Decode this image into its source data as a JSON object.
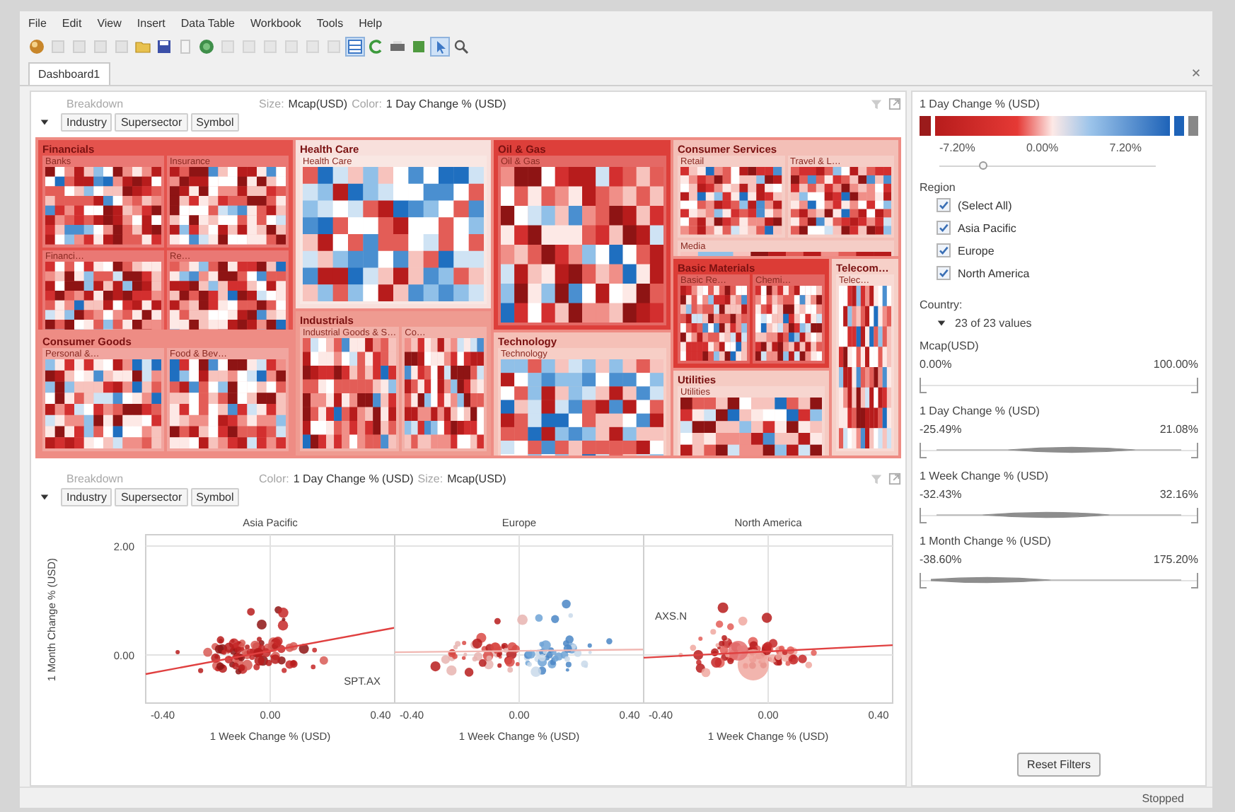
{
  "menu": [
    "File",
    "Edit",
    "View",
    "Insert",
    "Data Table",
    "Workbook",
    "Tools",
    "Help"
  ],
  "tabs": [
    {
      "label": "Dashboard1",
      "selected": true
    }
  ],
  "treemap": {
    "breakdown_label": "Breakdown",
    "size_label": "Size:",
    "size_value": "Mcap(USD)",
    "color_label": "Color:",
    "color_value": "1 Day Change % (USD)",
    "hierarchy": [
      "Industry",
      "Supersector",
      "Symbol"
    ],
    "groups": [
      {
        "label": "Financials",
        "color": "#e4534d",
        "subgroups": [
          "Banks",
          "Insurance",
          "Financi…",
          "Re…"
        ]
      },
      {
        "label": "Health Care",
        "color": "#f8e0dc",
        "subgroups": [
          "Health Care"
        ]
      },
      {
        "label": "Oil & Gas",
        "color": "#dd3f3a",
        "subgroups": [
          "Oil & Gas"
        ]
      },
      {
        "label": "Consumer Services",
        "color": "#f3bfb7",
        "subgroups": [
          "Retail",
          "Travel & L…",
          "Media"
        ]
      },
      {
        "label": "Basic Materials",
        "color": "#dc3c36",
        "subgroups": [
          "Basic Re…",
          "Chemi…"
        ]
      },
      {
        "label": "Telecom…",
        "color": "#f6d0c8",
        "subgroups": [
          "Telec…"
        ]
      },
      {
        "label": "Consumer Goods",
        "color": "#ee8c84",
        "subgroups": [
          "Personal &…",
          "Food & Bev…"
        ]
      },
      {
        "label": "Industrials",
        "color": "#ef9b91",
        "subgroups": [
          "Industrial Goods & S…",
          "Co…"
        ]
      },
      {
        "label": "Technology",
        "color": "#f5c0b7",
        "subgroups": [
          "Technology"
        ]
      },
      {
        "label": "Utilities",
        "color": "#f5cbc3",
        "subgroups": [
          "Utilities"
        ]
      }
    ]
  },
  "scatter": {
    "breakdown_label": "Breakdown",
    "color_label": "Color:",
    "color_value": "1 Day Change % (USD)",
    "size_label": "Size:",
    "size_value": "Mcap(USD)",
    "hierarchy": [
      "Industry",
      "Supersector",
      "Symbol"
    ],
    "ylabel": "1 Month Change % (USD)",
    "yticks": [
      "2.00",
      "0.00"
    ],
    "panels": [
      {
        "title": "Asia Pacific",
        "xticks": [
          "-0.40",
          "0.00",
          "0.40"
        ],
        "xlabel": "1 Week Change % (USD)",
        "annotation": "SPT.AX"
      },
      {
        "title": "Europe",
        "xticks": [
          "-0.40",
          "0.00",
          "0.40"
        ],
        "xlabel": "1 Week Change % (USD)"
      },
      {
        "title": "North America",
        "xticks": [
          "-0.40",
          "0.00",
          "0.40"
        ],
        "xlabel": "1 Week Change % (USD)",
        "annotation": "AXS.N"
      }
    ]
  },
  "color_legend": {
    "title": "1 Day Change % (USD)",
    "min": "-7.20%",
    "mid": "0.00%",
    "max": "7.20%",
    "level": 0.2
  },
  "region_filter": {
    "title": "Region",
    "items": [
      {
        "label": "(Select All)",
        "checked": true
      },
      {
        "label": "Asia Pacific",
        "checked": true
      },
      {
        "label": "Europe",
        "checked": true
      },
      {
        "label": "North America",
        "checked": true
      }
    ]
  },
  "country_filter": {
    "title": "Country:",
    "value": "23 of 23 values"
  },
  "range_filters": [
    {
      "title": "Mcap(USD)",
      "min": "0.00%",
      "max": "100.00%",
      "kind": "plain",
      "handles": [
        {
          "level": 0
        },
        {
          "level": 1
        }
      ]
    },
    {
      "title": "1 Day Change % (USD)",
      "min": "-25.49%",
      "max": "21.08%",
      "kind": "distribution",
      "handles": [
        {
          "level": 0
        },
        {
          "level": 1
        }
      ]
    },
    {
      "title": "1 Week Change % (USD)",
      "min": "-32.43%",
      "max": "32.16%",
      "kind": "distribution",
      "handles": [
        {
          "level": 0
        },
        {
          "level": 1
        }
      ]
    },
    {
      "title": "1 Month Change % (USD)",
      "min": "-38.60%",
      "max": "175.20%",
      "kind": "distribution",
      "handles": [
        {
          "level": 0
        },
        {
          "level": 1
        }
      ]
    }
  ],
  "reset_button": "Reset Filters",
  "status_bar": "Stopped"
}
